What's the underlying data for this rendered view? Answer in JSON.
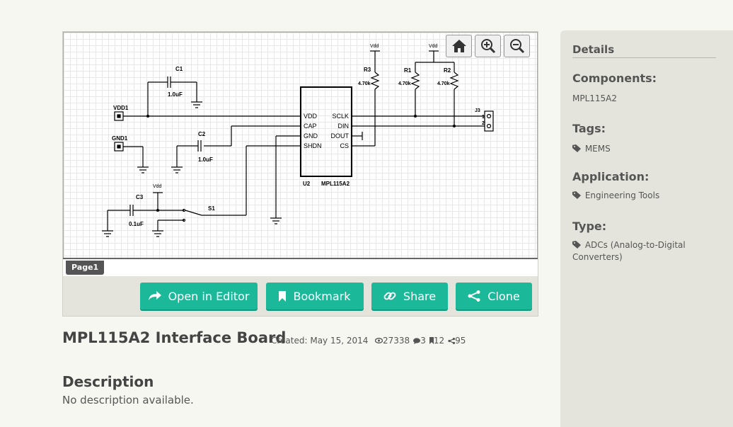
{
  "schematic": {
    "page_tab": "Page1",
    "components": {
      "vdd1": "VDD1",
      "gnd1": "GND1",
      "c1": "C1",
      "c1_val": "1.0uF",
      "c2": "C2",
      "c2_val": "1.0uF",
      "c3": "C3",
      "c3_val": "0.1uF",
      "r1": "R1",
      "r1_val": "4.70k",
      "r2": "R2",
      "r2_val": "4.70k",
      "r3": "R3",
      "r3_val": "4.70k",
      "vdd_label": "Vdd",
      "s1": "S1",
      "j3": "J3",
      "j3_pin1": "1",
      "j3_pin2": "2",
      "u2": "U2",
      "u2_name": "MPL115A2",
      "pins_left": [
        "VDD",
        "CAP",
        "GND",
        "SHDN"
      ],
      "pins_right": [
        "SCLK",
        "DIN",
        "DOUT",
        "CS"
      ]
    }
  },
  "toolbar": {
    "home_icon": "home-icon",
    "zoom_in_icon": "zoom-in-icon",
    "zoom_out_icon": "zoom-out-icon"
  },
  "actions": {
    "open_editor": "Open in Editor",
    "bookmark": "Bookmark",
    "share": "Share",
    "clone": "Clone"
  },
  "project": {
    "title": "MPL115A2 Interface Board",
    "created": "Created: May 15, 2014",
    "views": "27338",
    "comments": "3",
    "bookmarks": "12",
    "clones": "95"
  },
  "description": {
    "heading": "Description",
    "text": "No description available."
  },
  "details": {
    "heading": "Details",
    "components_label": "Components:",
    "components_value": "MPL115A2",
    "tags_label": "Tags:",
    "tags_value": "MEMS",
    "application_label": "Application:",
    "application_value": "Engineering Tools",
    "type_label": "Type:",
    "type_value": "ADCs (Analog-to-Digital Converters)"
  },
  "colors": {
    "accent": "#1cb89a",
    "sidebar_bg": "#e4e4dd",
    "page_bg": "#f7f7f2"
  }
}
